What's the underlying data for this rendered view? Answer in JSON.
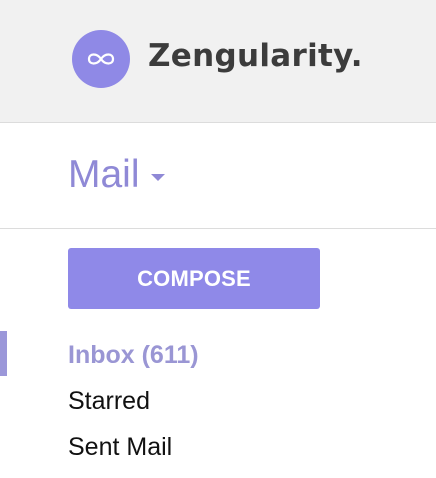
{
  "header": {
    "brand_name": "Zengularity.",
    "logo_icon": "infinity-icon",
    "logo_color": "#8f89e6"
  },
  "mail_menu": {
    "title": "Mail",
    "dropdown_icon": "caret-down-icon",
    "accent": "#8f89d6"
  },
  "compose": {
    "label": "COMPOSE",
    "color": "#8f89e8"
  },
  "nav": {
    "items": [
      {
        "label": "Inbox (611)",
        "active": true
      },
      {
        "label": "Starred",
        "active": false
      },
      {
        "label": "Sent Mail",
        "active": false
      }
    ]
  }
}
